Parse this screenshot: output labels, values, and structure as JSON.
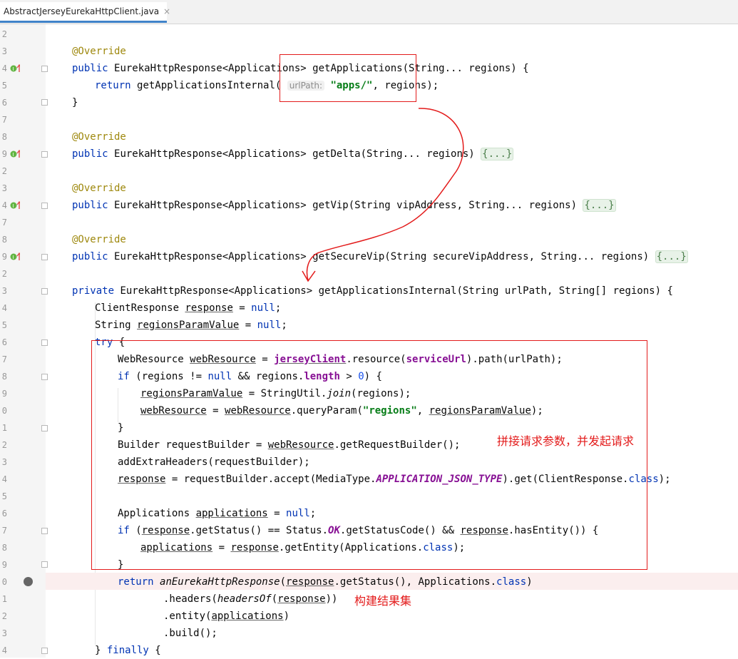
{
  "tab": {
    "title": "AbstractJerseyEurekaHttpClient.java",
    "close": "×"
  },
  "gutter_numbers": [
    "2",
    "3",
    "4",
    "5",
    "6",
    "7",
    "8",
    "9",
    "2",
    "3",
    "4",
    "7",
    "8",
    "9",
    "2",
    "3",
    "4",
    "5",
    "6",
    "7",
    "8",
    "9",
    "0",
    "1",
    "2",
    "3",
    "4",
    "5",
    "6",
    "7",
    "8",
    "9",
    "0",
    "1",
    "2",
    "3",
    "4"
  ],
  "code": {
    "l_ann1": "@Override",
    "l_getApps_pre": "public ",
    "l_getApps_mid": "EurekaHttpResponse<Applications> getApplications(String... regions) {",
    "l_return_kw": "return ",
    "l_return_call": "getApplicationsInternal( ",
    "l_hint": "urlPath:",
    "l_apps_str": "\"apps/\"",
    "l_return_tail": ", regions);",
    "l_close1": "}",
    "l_ann2": "@Override",
    "l_delta": "EurekaHttpResponse<Applications> getDelta(String... regions) ",
    "l_fold": "{...}",
    "l_ann3": "@Override",
    "l_vip": "EurekaHttpResponse<Applications> getVip(String vipAddress, String... regions) ",
    "l_ann4": "@Override",
    "l_svip": "EurekaHttpResponse<Applications> getSecureVip(String secureVipAddress, String... regions) ",
    "l_private": "private ",
    "l_internal": "EurekaHttpResponse<Applications> getApplicationsInternal(String urlPath, String[] regions) {",
    "l_cr": "ClientResponse ",
    "l_response": "response",
    "l_eq_null": " = ",
    "l_null": "null",
    "l_semi": ";",
    "l_string": "String ",
    "l_rpv": "regionsParamValue",
    "l_try": "try",
    "l_brace_open": " {",
    "l_wr": "WebResource ",
    "l_webResource": "webResource",
    "l_eq": " = ",
    "l_jersey": "jerseyClient",
    "l_resource": ".resource(",
    "l_serviceUrl": "serviceUrl",
    "l_path": ").path(urlPath);",
    "l_if": "if",
    "l_if_cond1": " (regions != ",
    "l_if_cond2": " && regions.",
    "l_length": "length",
    "l_gt": " > ",
    "l_zero": "0",
    "l_if_end": ") {",
    "l_join_pre": " = StringUtil.",
    "l_join": "join",
    "l_join_post": "(regions);",
    "l_qp": ".queryParam(",
    "l_regions_str": "\"regions\"",
    "l_qp_comma": ", ",
    "l_qp_end": ");",
    "l_builder": "Builder requestBuilder = ",
    "l_grb": ".getRequestBuilder();",
    "l_addextra": "addExtraHeaders(requestBuilder);",
    "l_accept": " = requestBuilder.accept(MediaType.",
    "l_json_type": "APPLICATION_JSON_TYPE",
    "l_get": ").get(ClientResponse.",
    "l_class": "class",
    "l_get_end": ");",
    "l_apps_type": "Applications ",
    "l_applications": "applications",
    "l_status1": " (",
    "l_status2": ".getStatus() == Status.",
    "l_ok": "OK",
    "l_status3": ".getStatusCode() && ",
    "l_status4": ".hasEntity()) {",
    "l_getentity": ".getEntity(Applications.",
    "l_ret_fn": "anEurekaHttpResponse",
    "l_ret_open": "(",
    "l_ret_mid": ".getStatus(), Applications.",
    "l_ret_end": ")",
    "l_headers": ".headers(",
    "l_headersOf": "headersOf",
    "l_headers_end": "))",
    "l_entity": ".entity(",
    "l_entity_end": ")",
    "l_build": ".build();",
    "l_finally_close": "} ",
    "l_finally": "finally"
  },
  "annotations": {
    "note1": "拼接请求参数，并发起请求",
    "note2": "构建结果集"
  }
}
